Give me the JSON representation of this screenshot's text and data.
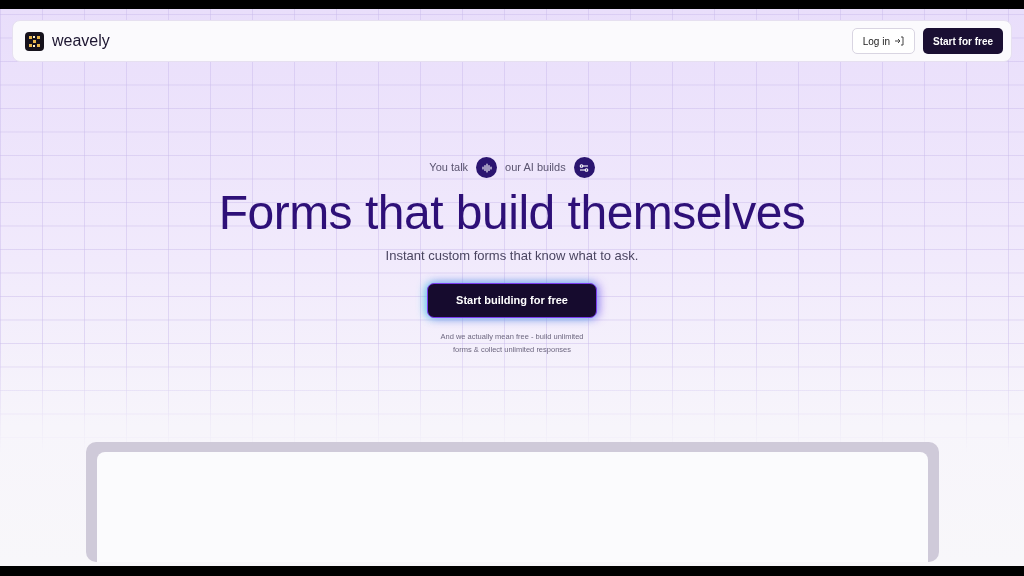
{
  "navbar": {
    "brand": "weavely",
    "login": "Log in",
    "cta": "Start for free"
  },
  "hero": {
    "tagline": [
      "You talk",
      "our AI builds"
    ],
    "title": "Forms that build themselves",
    "subtitle": "Instant custom forms that know what to ask.",
    "button": "Start building for free",
    "note": [
      "And we actually mean free - build unlimited",
      "forms & collect unlimited responses"
    ]
  }
}
